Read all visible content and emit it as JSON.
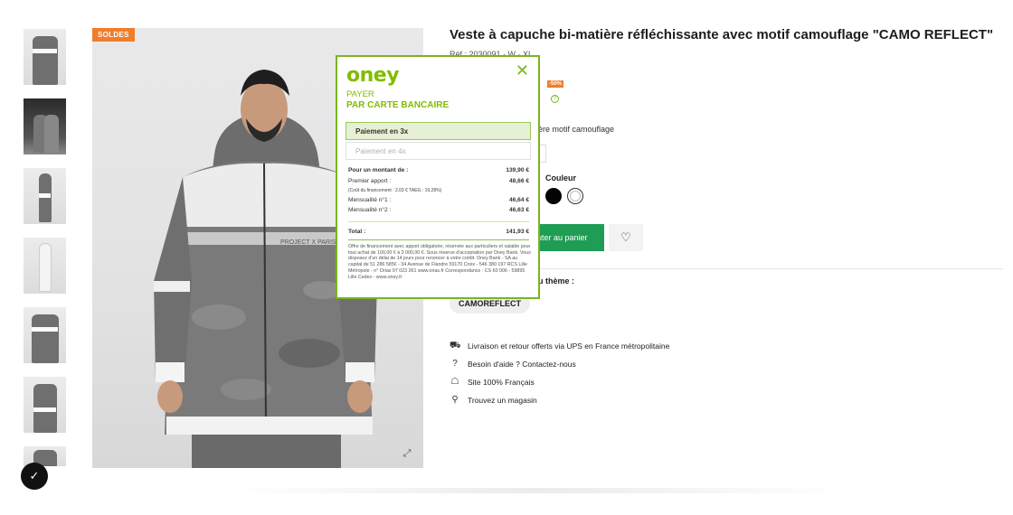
{
  "badge": {
    "soldes": "SOLDES"
  },
  "product": {
    "title": "Veste à capuche bi-matière réfléchissante avec motif camouflage \"CAMO REFLECT\"",
    "ref": "Réf : 2030091 · W · XL",
    "price_fragment": "€",
    "discount": "-50%",
    "help_icon": "?",
    "description": "ère motif camouflage",
    "color_label": "Couleur",
    "colors": [
      "#050505",
      "#ffffff"
    ],
    "add_to_cart": "uter au panier",
    "wishlist_icon": "heart-icon",
    "theme_label": "u thème :",
    "theme_tag": "CAMOREFLECT"
  },
  "services": [
    {
      "icon": "truck-icon",
      "glyph": "⛟",
      "label": "Livraison et retour offerts via UPS en France métropolitaine"
    },
    {
      "icon": "question-icon",
      "glyph": "?",
      "label": "Besoin d'aide ? Contactez-nous"
    },
    {
      "icon": "tshirt-icon",
      "glyph": "☖",
      "label": "Site 100% Français"
    },
    {
      "icon": "location-pin-icon",
      "glyph": "⚲",
      "label": "Trouvez un magasin"
    }
  ],
  "oney": {
    "logo": "oney",
    "close_icon": "✕",
    "payer": "PAYER",
    "par_carte": "PAR CARTE BANCAIRE",
    "options": [
      "Paiement en 3x",
      "Paiement en 4x"
    ],
    "amount_label": "Pour un montant de :",
    "amount_value": "139,90 €",
    "apport_label": "Premier apport :",
    "apport_value": "48,66 €",
    "cost_note": "(Coût du financement : 2,03 € TAEG : 19,28%)",
    "m1_label": "Mensualité n°1 :",
    "m1_value": "46,64 €",
    "m2_label": "Mensualité n°2 :",
    "m2_value": "46,63 €",
    "total_label": "Total :",
    "total_value": "141,93 €",
    "legal": "Offre de financement avec apport obligatoire, réservée aux particuliers et valable pour tout achat de 100,00 € à 3 000,00 €. Sous réserve d'acceptation par Oney Bank. Vous disposez d'un délai de 14 jours pour renoncer à votre crédit. Oney Bank - SA au capital de 51 286 585€ - 34 Avenue de Flandre 59170 Croix - 546 380 197 RCS Lille Métropole - n° Orias 07 023 261 www.orias.fr Correspondance : CS 60 006 - 59895 Lille Cedex - www.oney.fr"
  },
  "main_image": {
    "expand_icon": "expand-icon"
  },
  "trust_badge": {
    "glyph": "✓"
  }
}
